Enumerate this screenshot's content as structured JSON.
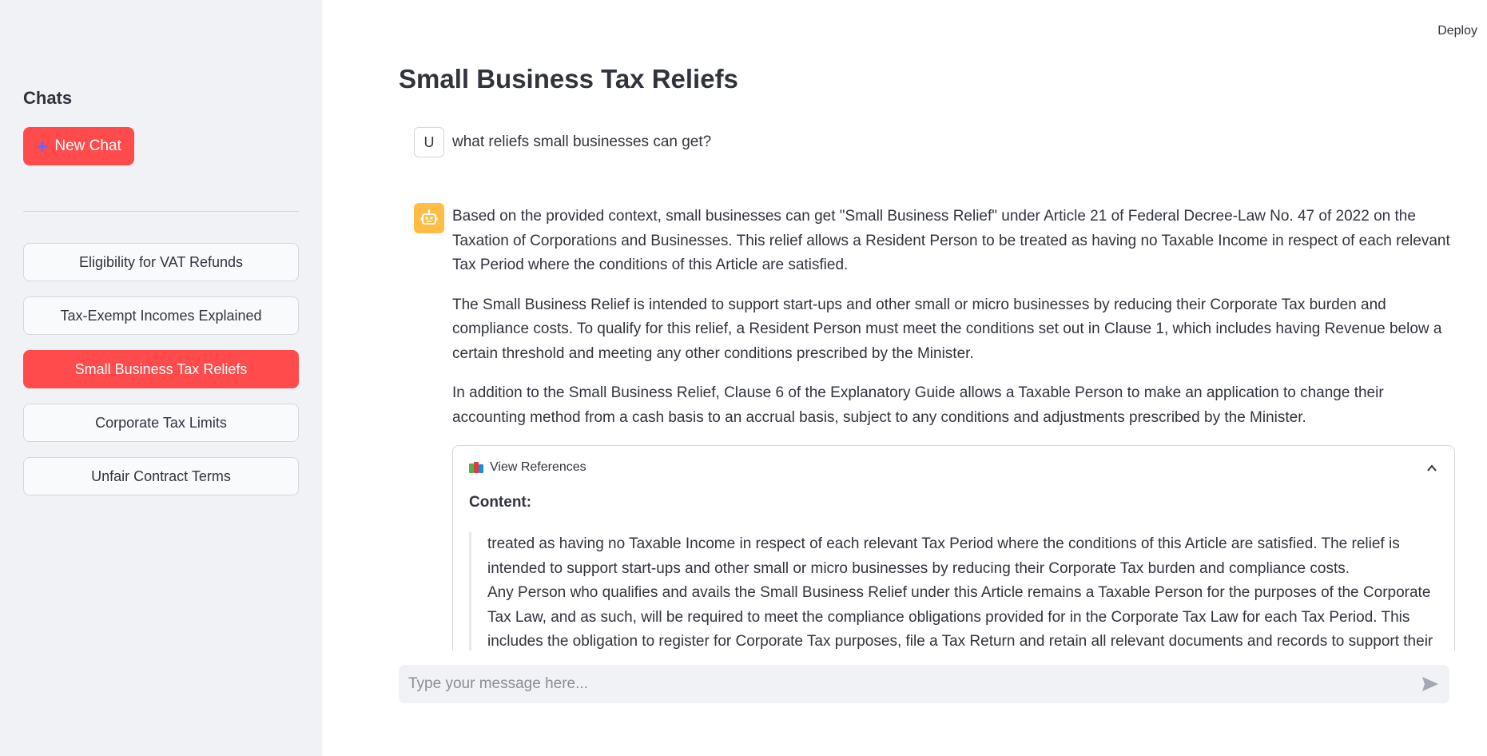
{
  "header": {
    "deploy_label": "Deploy"
  },
  "sidebar": {
    "title": "Chats",
    "new_chat_label": "New Chat",
    "items": [
      {
        "label": "Eligibility for VAT Refunds",
        "active": false
      },
      {
        "label": "Tax-Exempt Incomes Explained",
        "active": false
      },
      {
        "label": "Small Business Tax Reliefs",
        "active": true
      },
      {
        "label": "Corporate Tax Limits",
        "active": false
      },
      {
        "label": "Unfair Contract Terms",
        "active": false
      }
    ]
  },
  "main": {
    "title": "Small Business Tax Reliefs",
    "messages": {
      "user": {
        "avatar_letter": "U",
        "text": "what reliefs small businesses can get?"
      },
      "assistant": {
        "paragraphs": [
          "Based on the provided context, small businesses can get \"Small Business Relief\" under Article 21 of Federal Decree-Law No. 47 of 2022 on the Taxation of Corporations and Businesses. This relief allows a Resident Person to be treated as having no Taxable Income in respect of each relevant Tax Period where the conditions of this Article are satisfied.",
          "The Small Business Relief is intended to support start-ups and other small or micro businesses by reducing their Corporate Tax burden and compliance costs. To qualify for this relief, a Resident Person must meet the conditions set out in Clause 1, which includes having Revenue below a certain threshold and meeting any other conditions prescribed by the Minister.",
          "In addition to the Small Business Relief, Clause 6 of the Explanatory Guide allows a Taxable Person to make an application to change their accounting method from a cash basis to an accrual basis, subject to any conditions and adjustments prescribed by the Minister."
        ]
      }
    },
    "references": {
      "label": "View References",
      "content_label": "Content:",
      "lines": [
        "treated as having no Taxable Income in respect of each relevant Tax Period where the conditions of this Article are satisfied. The relief is intended to support start-ups and other small or micro businesses by reducing their Corporate Tax burden and compliance costs.",
        "Any Person who qualifies and avails the Small Business Relief under this Article remains a Taxable Person for the purposes of the Corporate Tax Law, and as such, will be required to meet the compliance obligations provided for in the Corporate Tax Law for each Tax Period. This includes the obligation to register for Corporate Tax purposes, file a Tax Return and retain all relevant documents and records to support their Corporate T ax"
      ]
    },
    "input": {
      "placeholder": "Type your message here..."
    }
  },
  "colors": {
    "accent": "#ff4b4b",
    "sidebar_bg": "#f0f2f6",
    "bot_avatar": "#ffbd45"
  },
  "icons": [
    "plus-icon",
    "robot-icon",
    "books-icon",
    "chevron-up-icon",
    "send-icon"
  ]
}
